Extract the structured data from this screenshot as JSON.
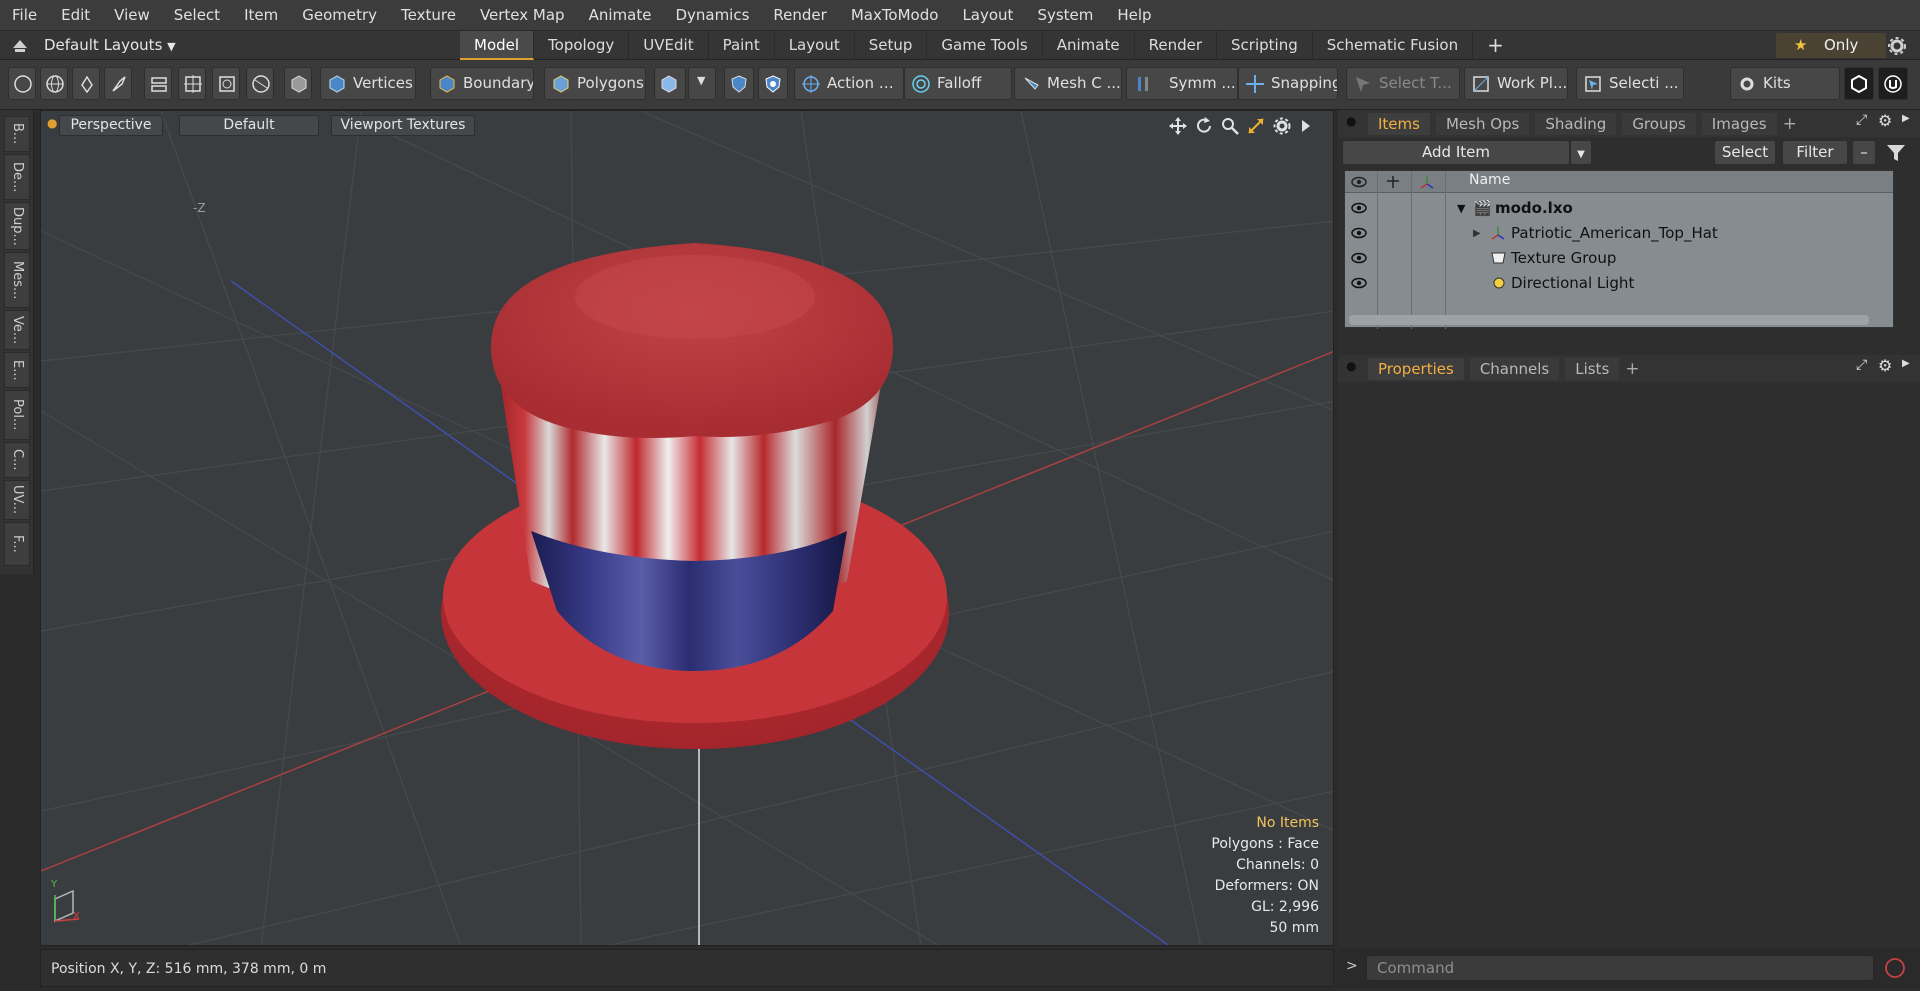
{
  "menu": [
    "File",
    "Edit",
    "View",
    "Select",
    "Item",
    "Geometry",
    "Texture",
    "Vertex Map",
    "Animate",
    "Dynamics",
    "Render",
    "MaxToModo",
    "Layout",
    "System",
    "Help"
  ],
  "layout": {
    "dropdown": "Default Layouts",
    "tabs": [
      "Model",
      "Topology",
      "UVEdit",
      "Paint",
      "Layout",
      "Setup",
      "Game Tools",
      "Animate",
      "Render",
      "Scripting",
      "Schematic Fusion"
    ],
    "active_tab": "Model",
    "only_label": "Only"
  },
  "toolbar": {
    "vertices": "Vertices",
    "boundary": "Boundary",
    "polygons": "Polygons",
    "action": "Action",
    "falloff": "Falloff",
    "mesh": "Mesh C ...",
    "symmetry": "Symm ...",
    "snapping": "Snapping",
    "select_t": "Select T...",
    "work_plane": "Work Pl...",
    "selection": "Selecti ...",
    "kits": "Kits"
  },
  "left_tabs": [
    "B...",
    "De...",
    "Dup...",
    "Mes...",
    "Ve...",
    "E...",
    "Pol...",
    "C...",
    "UV...",
    "F..."
  ],
  "viewport": {
    "view_mode": "Perspective",
    "shading": "Default",
    "textures": "Viewport Textures",
    "axis_label": "-Z",
    "info": {
      "no_items": "No Items",
      "polygons": "Polygons : Face",
      "channels": "Channels: 0",
      "deformers": "Deformers: ON",
      "gl": "GL: 2,996",
      "scale": "50 mm"
    },
    "gizmo": {
      "y": "Y",
      "x": "X"
    }
  },
  "status": {
    "position": "Position X, Y, Z:  516 mm, 378 mm, 0 m"
  },
  "items_panel": {
    "tabs": [
      "Items",
      "Mesh Ops",
      "Shading",
      "Groups",
      "Images"
    ],
    "active_tab": "Items",
    "add_item": "Add Item",
    "select": "Select",
    "filter": "Filter",
    "column_name": "Name",
    "rows": [
      {
        "label": "modo.lxo",
        "root": true
      },
      {
        "label": "Patriotic_American_Top_Hat"
      },
      {
        "label": "Texture Group"
      },
      {
        "label": "Directional Light"
      }
    ]
  },
  "properties_panel": {
    "tabs": [
      "Properties",
      "Channels",
      "Lists"
    ],
    "active_tab": "Properties"
  },
  "command": {
    "placeholder": "Command"
  },
  "colors": {
    "accent": "#f2b040",
    "hat_red": "#c02a30",
    "hat_blue": "#2a2d6e"
  }
}
